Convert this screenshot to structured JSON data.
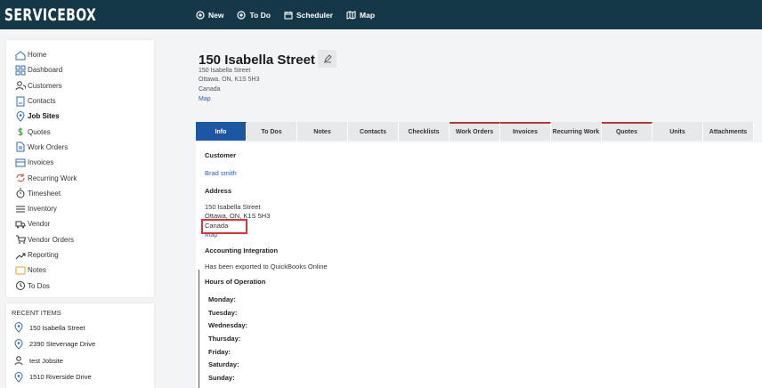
{
  "brand": "SERVICEBOX",
  "topnav": [
    {
      "label": "New",
      "icon": "plus-circle-icon"
    },
    {
      "label": "To Do",
      "icon": "plus-circle-icon"
    },
    {
      "label": "Scheduler",
      "icon": "calendar-icon"
    },
    {
      "label": "Map",
      "icon": "map-icon"
    }
  ],
  "sidebar": {
    "items": [
      {
        "label": "Home",
        "icon": "home-icon"
      },
      {
        "label": "Dashboard",
        "icon": "dashboard-icon"
      },
      {
        "label": "Customers",
        "icon": "users-icon"
      },
      {
        "label": "Contacts",
        "icon": "contacts-icon"
      },
      {
        "label": "Job Sites",
        "icon": "location-pin-icon"
      },
      {
        "label": "Quotes",
        "icon": "dollar-icon"
      },
      {
        "label": "Work Orders",
        "icon": "document-icon"
      },
      {
        "label": "Invoices",
        "icon": "invoice-icon"
      },
      {
        "label": "Recurring Work",
        "icon": "recurring-icon"
      },
      {
        "label": "Timesheet",
        "icon": "stopwatch-icon"
      },
      {
        "label": "Inventory",
        "icon": "list-icon"
      },
      {
        "label": "Vendor",
        "icon": "truck-icon"
      },
      {
        "label": "Vendor Orders",
        "icon": "cart-icon"
      },
      {
        "label": "Reporting",
        "icon": "trend-icon"
      },
      {
        "label": "Notes",
        "icon": "note-icon"
      },
      {
        "label": "To Dos",
        "icon": "clock-icon"
      }
    ],
    "active_index": 4
  },
  "recent": {
    "header": "RECENT ITEMS",
    "items": [
      {
        "label": "150 Isabella Street",
        "icon": "location-pin-icon"
      },
      {
        "label": "2390 Stevenage Drive",
        "icon": "location-pin-icon"
      },
      {
        "label": "test Jobsite",
        "icon": "user-icon"
      },
      {
        "label": "1510 Riverside Drive",
        "icon": "location-pin-icon"
      }
    ]
  },
  "page": {
    "title": "150 Isabella Street",
    "address_lines": [
      "150 Isabella Street",
      "Ottawa, ON, K1S 5H3",
      "Canada"
    ],
    "map_link": "Map"
  },
  "tabs": [
    {
      "label": "Info",
      "active": true,
      "red": false
    },
    {
      "label": "To Dos",
      "active": false,
      "red": false
    },
    {
      "label": "Notes",
      "active": false,
      "red": false
    },
    {
      "label": "Contacts",
      "active": false,
      "red": false
    },
    {
      "label": "Checklists",
      "active": false,
      "red": false
    },
    {
      "label": "Work Orders",
      "active": false,
      "red": true
    },
    {
      "label": "Invoices",
      "active": false,
      "red": true
    },
    {
      "label": "Recurring Work",
      "active": false,
      "red": false
    },
    {
      "label": "Quotes",
      "active": false,
      "red": true
    },
    {
      "label": "Units",
      "active": false,
      "red": false
    },
    {
      "label": "Attachments",
      "active": false,
      "red": false
    }
  ],
  "info": {
    "customer_heading": "Customer",
    "customer_name": "Brad smith",
    "address_heading": "Address",
    "address_line1": "150 Isabella Street",
    "address_line2": "Ottawa, ON, K1S 5H3",
    "address_line3": "Canada",
    "address_map": "Map",
    "accounting_heading": "Accounting Integration",
    "accounting_text": "Has been exported to QuickBooks Online",
    "hours_heading": "Hours of Operation",
    "days": [
      "Monday:",
      "Tuesday:",
      "Wednesday:",
      "Thursday:",
      "Friday:",
      "Saturday:",
      "Sunday:"
    ]
  },
  "colors": {
    "topbar": "#143848",
    "active_tab": "#1c57a5",
    "link": "#2b5fb5",
    "highlight": "#d9343a"
  }
}
